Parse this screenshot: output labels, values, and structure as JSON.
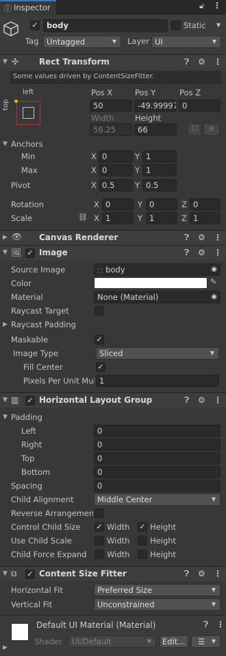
{
  "tab": {
    "title": "Inspector"
  },
  "go": {
    "name": "body",
    "static_label": "Static",
    "tag_label": "Tag",
    "tag_value": "Untagged",
    "layer_label": "Layer",
    "layer_value": "UI"
  },
  "rect": {
    "title": "Rect Transform",
    "info": "Some values driven by ContentSizeFitter.",
    "anchor_left": "left",
    "anchor_top": "top",
    "posx_label": "Pos X",
    "posy_label": "Pos Y",
    "posz_label": "Pos Z",
    "posx": "50",
    "posy": "-49.99997",
    "posz": "0",
    "width_label": "Width",
    "height_label": "Height",
    "width": "56.25",
    "height": "66",
    "r_button": "R",
    "anchors_label": "Anchors",
    "min_label": "Min",
    "max_label": "Max",
    "min_x": "0",
    "min_y": "1",
    "max_x": "0",
    "max_y": "1",
    "pivot_label": "Pivot",
    "pivot_x": "0.5",
    "pivot_y": "0.5",
    "rotation_label": "Rotation",
    "rot_x": "0",
    "rot_y": "0",
    "rot_z": "0",
    "scale_label": "Scale",
    "scale_x": "1",
    "scale_y": "1",
    "scale_z": "1",
    "x": "X",
    "y": "Y",
    "z": "Z"
  },
  "canvas": {
    "title": "Canvas Renderer"
  },
  "image": {
    "title": "Image",
    "source_label": "Source Image",
    "source_value": "body",
    "color_label": "Color",
    "material_label": "Material",
    "material_value": "None (Material)",
    "raycast_target_label": "Raycast Target",
    "raycast_padding_label": "Raycast Padding",
    "maskable_label": "Maskable",
    "image_type_label": "Image Type",
    "image_type_value": "Sliced",
    "fill_center_label": "Fill Center",
    "ppu_label": "Pixels Per Unit Mul",
    "ppu_value": "1"
  },
  "hlg": {
    "title": "Horizontal Layout Group",
    "padding_label": "Padding",
    "left_label": "Left",
    "right_label": "Right",
    "top_label": "Top",
    "bottom_label": "Bottom",
    "left": "0",
    "right": "0",
    "top": "0",
    "bottom": "0",
    "spacing_label": "Spacing",
    "spacing": "0",
    "child_alignment_label": "Child Alignment",
    "child_alignment_value": "Middle Center",
    "reverse_label": "Reverse Arrangement",
    "control_label": "Control Child Size",
    "use_scale_label": "Use Child Scale",
    "force_expand_label": "Child Force Expand",
    "width_label": "Width",
    "height_label": "Height"
  },
  "csf": {
    "title": "Content Size Fitter",
    "hfit_label": "Horizontal Fit",
    "hfit_value": "Preferred Size",
    "vfit_label": "Vertical Fit",
    "vfit_value": "Unconstrained"
  },
  "mat": {
    "title": "Default UI Material (Material)",
    "shader_label": "Shader",
    "shader_value": "UI/Default",
    "edit_button": "Edit..."
  },
  "colors": {
    "bg": "#383838",
    "header": "#3e3e3e",
    "field": "#2a2a2a",
    "accent": "#e8b400",
    "color_swatch": "#ffffff"
  }
}
